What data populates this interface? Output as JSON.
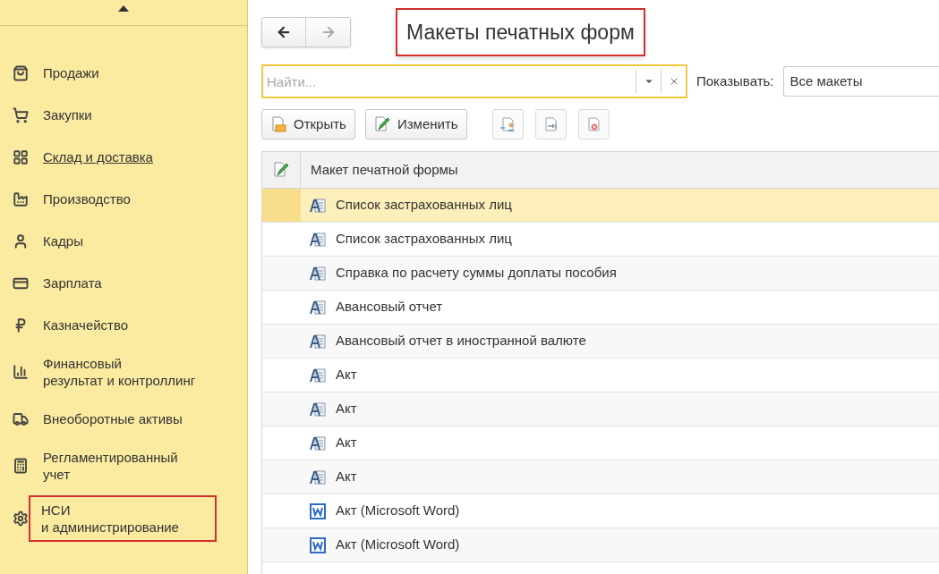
{
  "sidebar": {
    "items": [
      {
        "label": "Продажи",
        "hovered": false,
        "highlighted": false
      },
      {
        "label": "Закупки",
        "hovered": false,
        "highlighted": false
      },
      {
        "label": "Склад и доставка",
        "hovered": true,
        "highlighted": false
      },
      {
        "label": "Производство",
        "hovered": false,
        "highlighted": false
      },
      {
        "label": "Кадры",
        "hovered": false,
        "highlighted": false
      },
      {
        "label": "Зарплата",
        "hovered": false,
        "highlighted": false
      },
      {
        "label": "Казначейство",
        "hovered": false,
        "highlighted": false
      },
      {
        "label": "Финансовый\nрезультат и контроллинг",
        "hovered": false,
        "highlighted": false
      },
      {
        "label": "Внеоборотные активы",
        "hovered": false,
        "highlighted": false
      },
      {
        "label": "Регламентированный\nучет",
        "hovered": false,
        "highlighted": false
      },
      {
        "label": "НСИ\nи администрирование",
        "hovered": false,
        "highlighted": true
      }
    ]
  },
  "title": {
    "text": "Макеты печатных форм",
    "highlighted": true
  },
  "search": {
    "placeholder": "Найти...",
    "focused": true
  },
  "filter": {
    "label": "Показывать:",
    "value": "Все макеты"
  },
  "toolbar": {
    "buttons": [
      {
        "label": "Открыть"
      },
      {
        "label": "Изменить"
      }
    ]
  },
  "table": {
    "columns": [
      "Макет печатной формы"
    ],
    "rows": [
      {
        "name": "Список застрахованных лиц",
        "kind": "mxl",
        "selected": true
      },
      {
        "name": "Список застрахованных лиц",
        "kind": "mxl",
        "selected": false
      },
      {
        "name": "Справка по расчету суммы доплаты пособия",
        "kind": "mxl",
        "selected": false
      },
      {
        "name": "Авансовый отчет",
        "kind": "mxl",
        "selected": false
      },
      {
        "name": "Авансовый отчет в иностранной валюте",
        "kind": "mxl",
        "selected": false
      },
      {
        "name": "Акт",
        "kind": "mxl",
        "selected": false
      },
      {
        "name": "Акт",
        "kind": "mxl",
        "selected": false
      },
      {
        "name": "Акт",
        "kind": "mxl",
        "selected": false
      },
      {
        "name": "Акт",
        "kind": "mxl",
        "selected": false
      },
      {
        "name": "Акт (Microsoft Word)",
        "kind": "word",
        "selected": false
      },
      {
        "name": "Акт (Microsoft Word)",
        "kind": "word",
        "selected": false
      }
    ]
  }
}
